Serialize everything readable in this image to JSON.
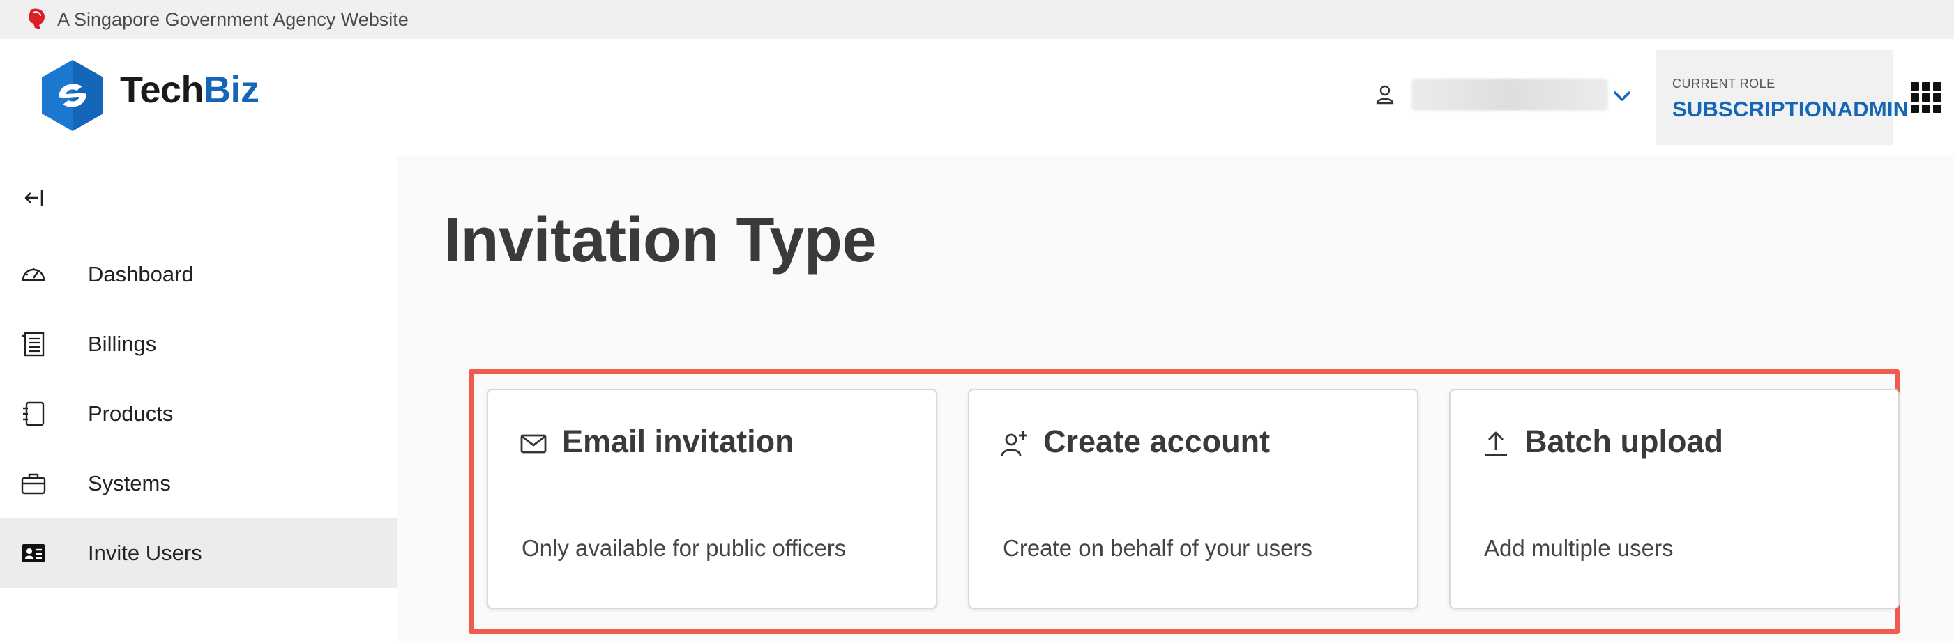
{
  "masthead": {
    "text": "A Singapore Government Agency Website"
  },
  "header": {
    "brand_part1": "Tech",
    "brand_part2": "Biz",
    "role_label": "CURRENT ROLE",
    "role_value": "SUBSCRIPTIONADMIN"
  },
  "sidebar": {
    "items": [
      {
        "label": "Dashboard",
        "icon": "speedometer-icon"
      },
      {
        "label": "Billings",
        "icon": "receipt-icon"
      },
      {
        "label": "Products",
        "icon": "notebook-icon"
      },
      {
        "label": "Systems",
        "icon": "briefcase-icon"
      },
      {
        "label": "Invite Users",
        "icon": "id-card-icon",
        "active": true
      }
    ]
  },
  "main": {
    "title": "Invitation Type",
    "cards": [
      {
        "title": "Email invitation",
        "description": "Only available for public officers",
        "icon": "envelope-icon"
      },
      {
        "title": "Create account",
        "description": "Create on behalf of your users",
        "icon": "add-user-icon"
      },
      {
        "title": "Batch upload",
        "description": "Add multiple users",
        "icon": "upload-icon"
      }
    ]
  },
  "colors": {
    "brand_blue": "#1466b8",
    "highlight_red": "#f05a4f",
    "masthead_bg": "#f0f0f0",
    "active_nav_bg": "#ececec"
  }
}
